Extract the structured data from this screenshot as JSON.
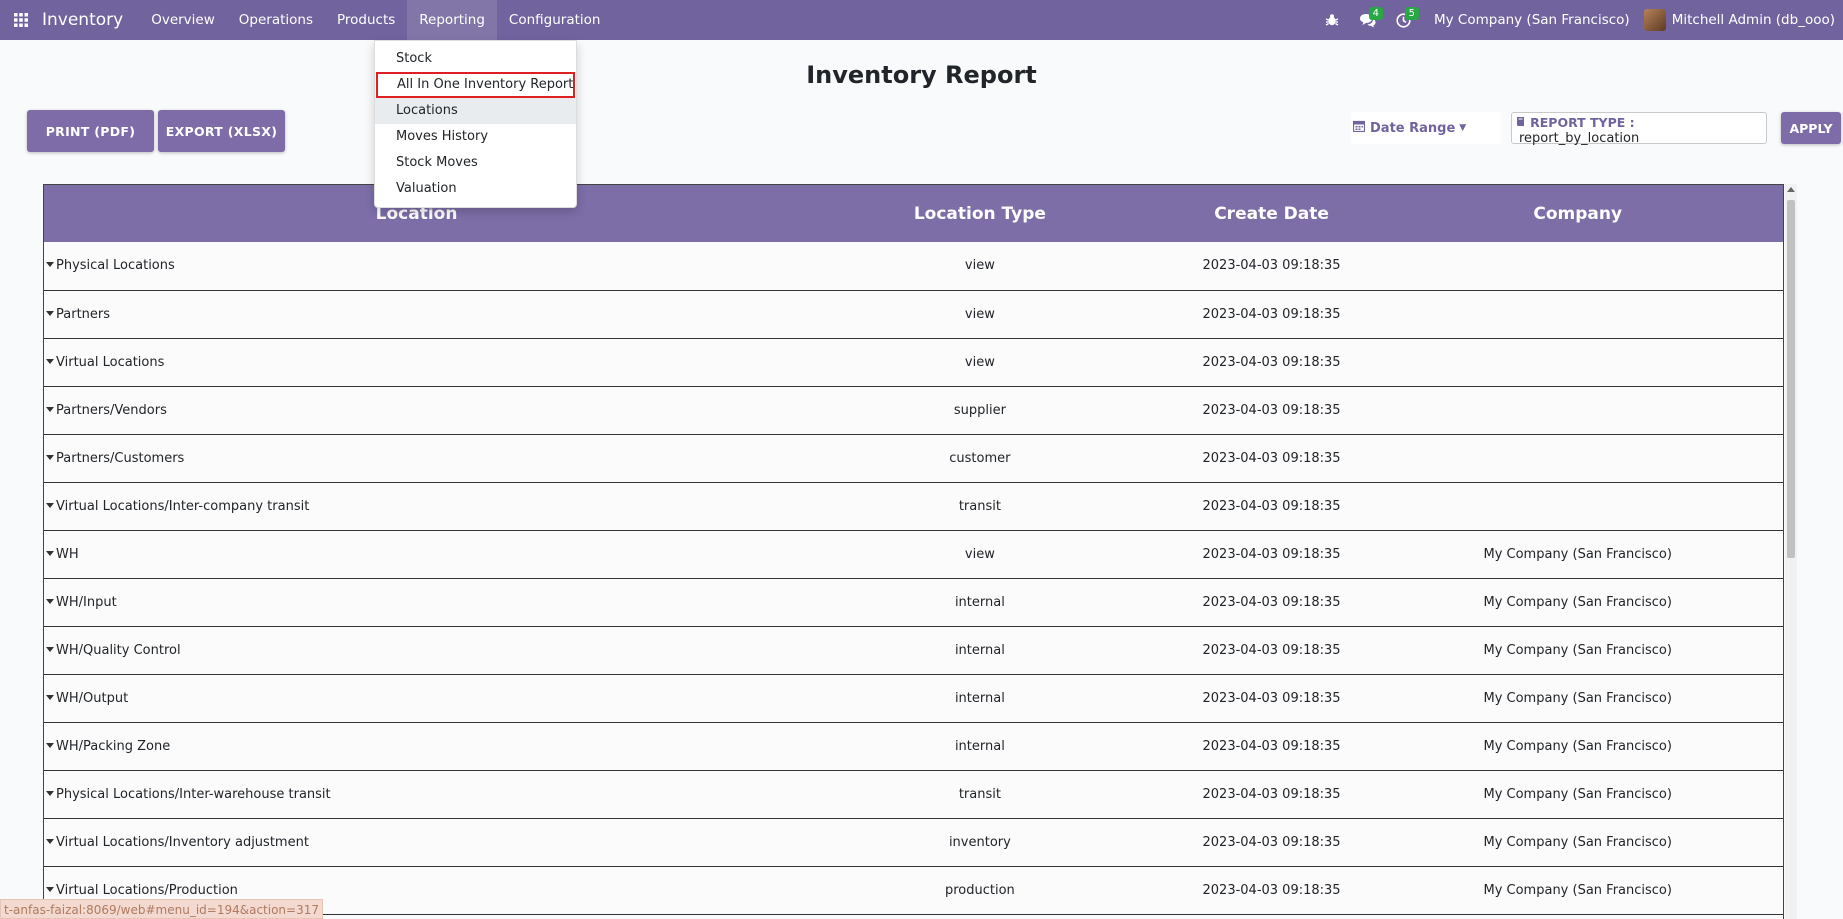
{
  "navbar": {
    "brand": "Inventory",
    "menu": [
      "Overview",
      "Operations",
      "Products",
      "Reporting",
      "Configuration"
    ],
    "messages_count": "4",
    "activities_count": "5",
    "company": "My Company (San Francisco)",
    "user": "Mitchell Admin (db_ooo)"
  },
  "dropdown": {
    "items": [
      "Stock",
      "All In One Inventory Report",
      "Locations",
      "Moves History",
      "Stock Moves",
      "Valuation"
    ]
  },
  "page": {
    "title": "Inventory Report",
    "print_label": "PRINT (PDF)",
    "export_label": "EXPORT (XLSX)",
    "date_range_label": "Date Range",
    "report_type_label": "REPORT TYPE :",
    "report_type_value": "report_by_location",
    "apply_label": "APPLY"
  },
  "table": {
    "headers": [
      "Location",
      "Location Type",
      "Create Date",
      "Company"
    ],
    "rows": [
      {
        "location": "Physical Locations",
        "type": "view",
        "date": "2023-04-03 09:18:35",
        "company": ""
      },
      {
        "location": "Partners",
        "type": "view",
        "date": "2023-04-03 09:18:35",
        "company": ""
      },
      {
        "location": "Virtual Locations",
        "type": "view",
        "date": "2023-04-03 09:18:35",
        "company": ""
      },
      {
        "location": "Partners/Vendors",
        "type": "supplier",
        "date": "2023-04-03 09:18:35",
        "company": ""
      },
      {
        "location": "Partners/Customers",
        "type": "customer",
        "date": "2023-04-03 09:18:35",
        "company": ""
      },
      {
        "location": "Virtual Locations/Inter-company transit",
        "type": "transit",
        "date": "2023-04-03 09:18:35",
        "company": ""
      },
      {
        "location": "WH",
        "type": "view",
        "date": "2023-04-03 09:18:35",
        "company": "My Company (San Francisco)"
      },
      {
        "location": "WH/Input",
        "type": "internal",
        "date": "2023-04-03 09:18:35",
        "company": "My Company (San Francisco)"
      },
      {
        "location": "WH/Quality Control",
        "type": "internal",
        "date": "2023-04-03 09:18:35",
        "company": "My Company (San Francisco)"
      },
      {
        "location": "WH/Output",
        "type": "internal",
        "date": "2023-04-03 09:18:35",
        "company": "My Company (San Francisco)"
      },
      {
        "location": "WH/Packing Zone",
        "type": "internal",
        "date": "2023-04-03 09:18:35",
        "company": "My Company (San Francisco)"
      },
      {
        "location": "Physical Locations/Inter-warehouse transit",
        "type": "transit",
        "date": "2023-04-03 09:18:35",
        "company": "My Company (San Francisco)"
      },
      {
        "location": "Virtual Locations/Inventory adjustment",
        "type": "inventory",
        "date": "2023-04-03 09:18:35",
        "company": "My Company (San Francisco)"
      },
      {
        "location": "Virtual Locations/Production",
        "type": "production",
        "date": "2023-04-03 09:18:35",
        "company": "My Company (San Francisco)"
      }
    ]
  },
  "status_url": "t-anfas-faizal:8069/web#menu_id=194&action=317",
  "colors": {
    "navbar": "#71639e",
    "button": "#7e6ca9",
    "table_header": "#7d6ea8",
    "highlight": "#e02020",
    "badge": "#28a745"
  }
}
